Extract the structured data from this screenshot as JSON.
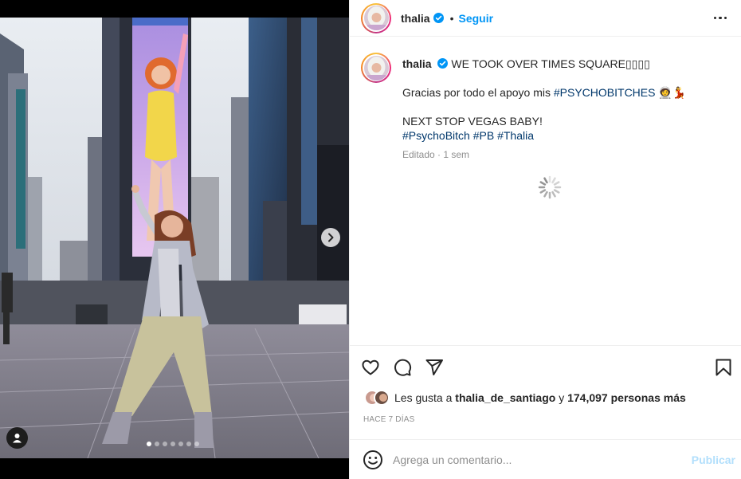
{
  "post": {
    "username": "thalia",
    "separator": "•",
    "follow_label": "Seguir",
    "caption_title": "WE TOOK OVER TIMES SQUARE▯▯▯▯",
    "caption_line2_prefix": "Gracias por todo el apoyo mis ",
    "caption_line2_tag": "#PSYCHOBITCHES",
    "caption_line2_emoji": "🧑‍🚀💃",
    "caption_line3": "NEXT STOP VEGAS BABY!",
    "hashtags": [
      "#PsychoBitch",
      "#PB",
      "#Thalia"
    ],
    "edited_label": "Editado",
    "edited_time": "1 sem",
    "likes_prefix": "Les gusta a ",
    "likes_user": "thalia_de_santiago",
    "likes_conj": " y ",
    "likes_count": "174,097 personas más",
    "time_ago": "HACE 7 DÍAS",
    "comment_placeholder": "Agrega un comentario...",
    "publish_label": "Publicar"
  },
  "carousel": {
    "slide_count": 7,
    "active_index": 0
  },
  "icons": {
    "verified": "verified-badge-icon",
    "more": "more-options-icon",
    "like": "heart-icon",
    "comment": "comment-icon",
    "share": "share-icon",
    "save": "bookmark-icon",
    "emoji": "emoji-icon",
    "next": "chevron-right-icon",
    "tags": "user-tag-icon",
    "loading": "loading-spinner-icon"
  },
  "colors": {
    "accent": "#0095f6",
    "hashtag": "#00376b",
    "muted": "#8e8e8e",
    "publish_disabled": "#b2dffc"
  }
}
